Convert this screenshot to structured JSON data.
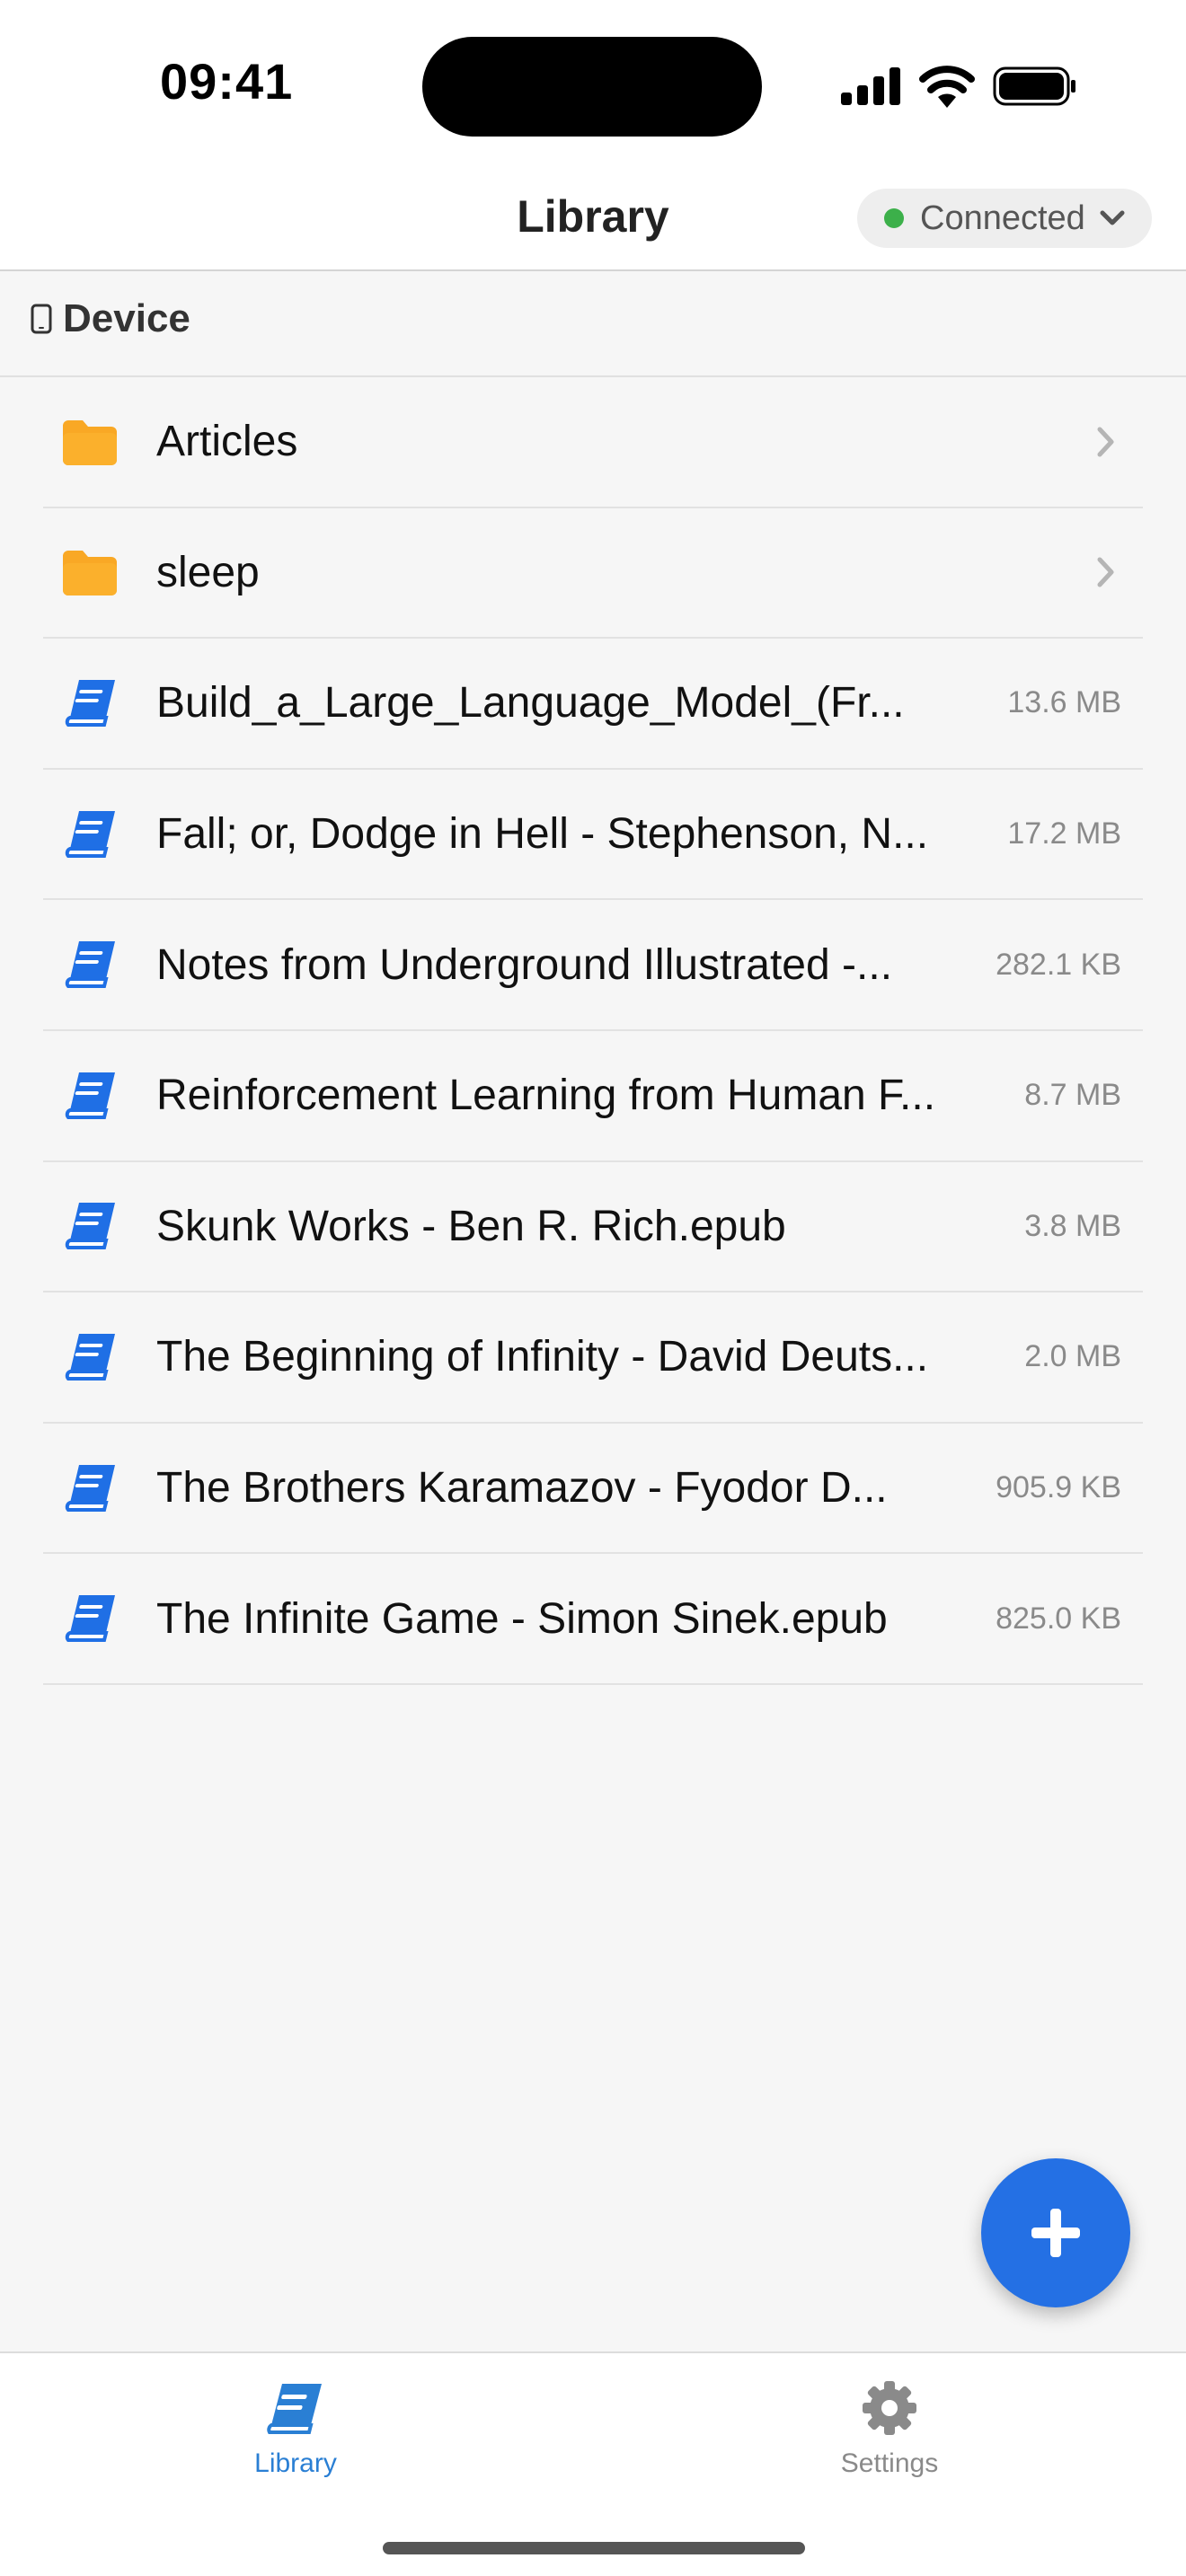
{
  "status_bar": {
    "time": "09:41"
  },
  "nav": {
    "title": "Library",
    "connection": {
      "label": "Connected",
      "color": "#3cb04a"
    }
  },
  "section": {
    "label": "Device"
  },
  "items": [
    {
      "type": "folder",
      "name": "Articles",
      "size": ""
    },
    {
      "type": "folder",
      "name": "sleep",
      "size": ""
    },
    {
      "type": "book",
      "name": "Build_a_Large_Language_Model_(Fr...",
      "size": "13.6 MB"
    },
    {
      "type": "book",
      "name": "Fall; or, Dodge in Hell - Stephenson, N...",
      "size": "17.2 MB"
    },
    {
      "type": "book",
      "name": "Notes from Underground Illustrated -...",
      "size": "282.1 KB"
    },
    {
      "type": "book",
      "name": "Reinforcement Learning from Human F...",
      "size": "8.7 MB"
    },
    {
      "type": "book",
      "name": "Skunk Works - Ben R. Rich.epub",
      "size": "3.8 MB"
    },
    {
      "type": "book",
      "name": "The Beginning of Infinity - David Deuts...",
      "size": "2.0 MB"
    },
    {
      "type": "book",
      "name": "The Brothers Karamazov - Fyodor D...",
      "size": "905.9 KB"
    },
    {
      "type": "book",
      "name": "The Infinite Game - Simon Sinek.epub",
      "size": "825.0 KB"
    }
  ],
  "tabs": [
    {
      "label": "Library",
      "icon": "book-icon",
      "active": true
    },
    {
      "label": "Settings",
      "icon": "gear-icon",
      "active": false
    }
  ],
  "colors": {
    "accent": "#2470e4",
    "folder": "#f9a825",
    "book": "#1f6fe5",
    "tab_active": "#2a7fd4"
  }
}
